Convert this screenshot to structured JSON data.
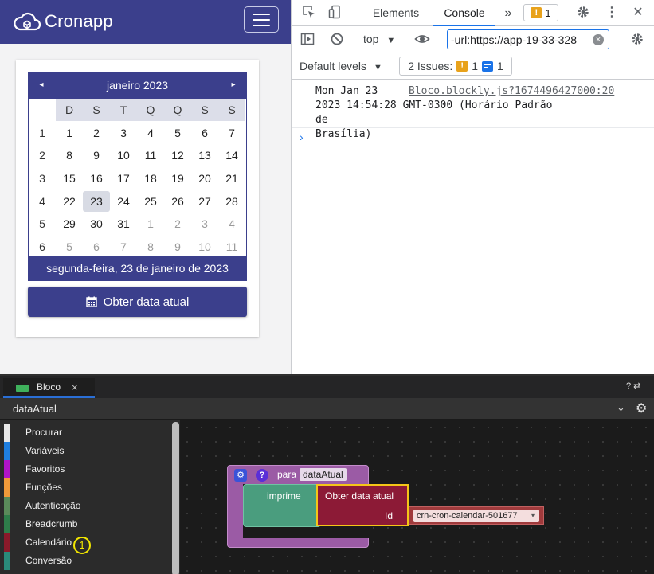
{
  "app": {
    "logo_text": "Cronapp",
    "calendar": {
      "month_label": "janeiro 2023",
      "prev_arrow": "◂",
      "next_arrow": "▸",
      "weekdays": [
        "D",
        "S",
        "T",
        "Q",
        "Q",
        "S",
        "S"
      ],
      "weeks": [
        {
          "num": "1",
          "days": [
            "1",
            "2",
            "3",
            "4",
            "5",
            "6",
            "7"
          ]
        },
        {
          "num": "2",
          "days": [
            "8",
            "9",
            "10",
            "11",
            "12",
            "13",
            "14"
          ]
        },
        {
          "num": "3",
          "days": [
            "15",
            "16",
            "17",
            "18",
            "19",
            "20",
            "21"
          ]
        },
        {
          "num": "4",
          "days": [
            "22",
            "23",
            "24",
            "25",
            "26",
            "27",
            "28"
          ]
        },
        {
          "num": "5",
          "days": [
            "29",
            "30",
            "31",
            "1",
            "2",
            "3",
            "4"
          ]
        },
        {
          "num": "6",
          "days": [
            "5",
            "6",
            "7",
            "8",
            "9",
            "10",
            "11"
          ]
        }
      ],
      "selected_day": "23",
      "footer_text": "segunda-feira, 23 de janeiro de 2023"
    },
    "button_label": "Obter data atual",
    "accent_color": "#3b3f8c"
  },
  "devtools": {
    "tabs": {
      "elements": "Elements",
      "console": "Console",
      "more": "»"
    },
    "issue_badge_count": "1",
    "context": "top",
    "filter_value": "-url:https://app-19-33-328",
    "levels_label": "Default levels",
    "issues_label": "2 Issues:",
    "issues_warn_count": "1",
    "issues_info_count": "1",
    "log": {
      "text": "Mon Jan 23\n2023 14:54:28 GMT-0300 (Horário Padrão de\nBrasília)",
      "source": "Bloco.blockly.js?1674496427000:20"
    },
    "prompt": "›"
  },
  "editor": {
    "tab_label": "Bloco",
    "tab_close": "×",
    "top_icons": "?  ⇄",
    "function_name": "dataAtual",
    "toolbox": [
      {
        "label": "Procurar",
        "color": "#e8e8e8"
      },
      {
        "label": "Variáveis",
        "color": "#1f7fe0"
      },
      {
        "label": "Favoritos",
        "color": "#b014c8"
      },
      {
        "label": "Funções",
        "color": "#f09a3a"
      },
      {
        "label": "Autenticação",
        "color": "#5a8a5a"
      },
      {
        "label": "Breadcrumb",
        "color": "#2e7d4a"
      },
      {
        "label": "Calendário",
        "color": "#8a1a2a"
      },
      {
        "label": "Conversão",
        "color": "#2a8a7a"
      }
    ],
    "toolbox_badge": "1",
    "blocks": {
      "function_prefix": "para",
      "function_name": "dataAtual",
      "print_label": "imprime",
      "get_label": "Obter data atual",
      "id_label": "Id",
      "id_value": "crn-cron-calendar-501677",
      "id_caret": "▾"
    }
  }
}
